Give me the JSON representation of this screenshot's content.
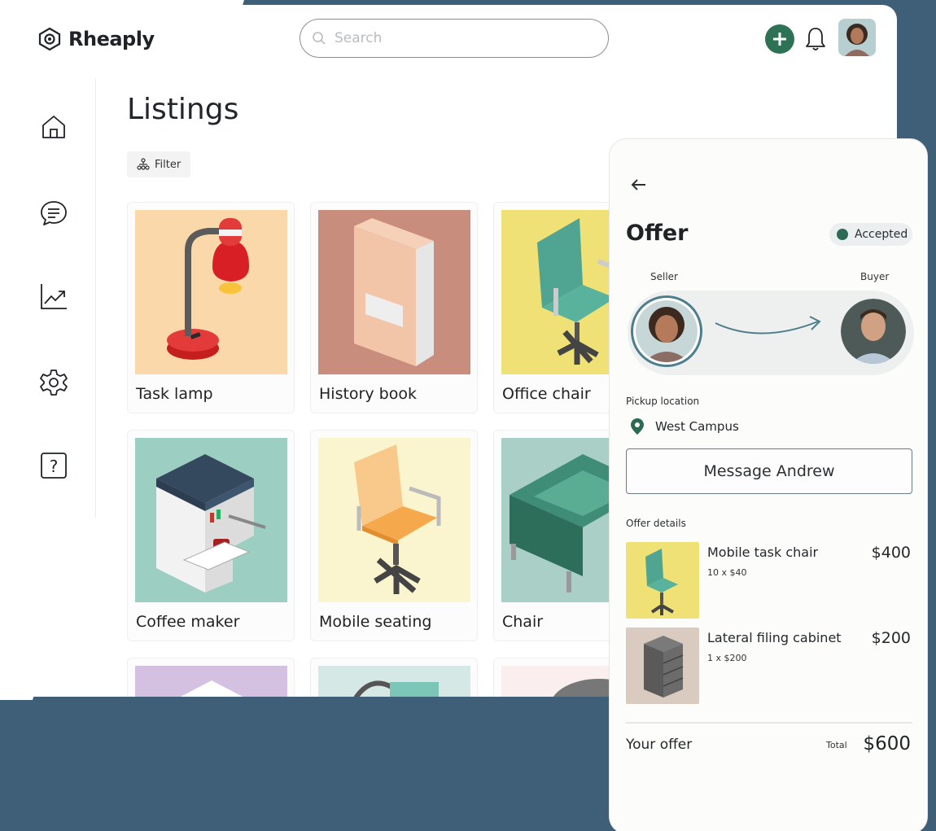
{
  "brand": {
    "name": "Rheaply"
  },
  "search": {
    "placeholder": "Search"
  },
  "page": {
    "title": "Listings",
    "filter_label": "Filter"
  },
  "sidebar": {
    "items": [
      "home-icon",
      "chat-icon",
      "analytics-icon",
      "settings-icon",
      "help-icon"
    ]
  },
  "listings": [
    {
      "label": "Task lamp",
      "bg": "#fbd8aa"
    },
    {
      "label": "History book",
      "bg": "#c98d7d"
    },
    {
      "label": "Office chair",
      "bg": "#efe176"
    },
    {
      "label": "Coffee maker",
      "bg": "#9ccfc2"
    },
    {
      "label": "Mobile seating",
      "bg": "#fbf5cf"
    },
    {
      "label": "Chair",
      "bg": "#aacfc6"
    }
  ],
  "offer": {
    "title": "Offer",
    "status": "Accepted",
    "seller_label": "Seller",
    "buyer_label": "Buyer",
    "pickup_label": "Pickup location",
    "pickup_location": "West Campus",
    "message_button": "Message Andrew",
    "details_label": "Offer details",
    "items": [
      {
        "name": "Mobile task chair",
        "qty": "10 x $40",
        "price": "$400"
      },
      {
        "name": "Lateral filing cabinet",
        "qty": "1 x $200",
        "price": "$200"
      }
    ],
    "your_offer_label": "Your offer",
    "total_label": "Total",
    "total_value": "$600"
  },
  "colors": {
    "accent": "#2e7256",
    "background": "#3f5f78",
    "status_dot": "#2c6a55"
  }
}
